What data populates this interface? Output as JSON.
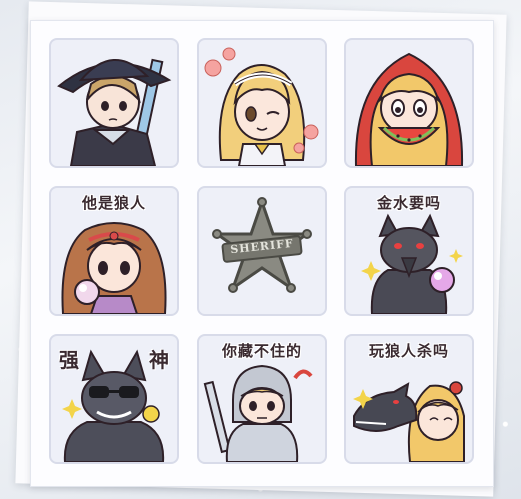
{
  "stickers": [
    {
      "name": "hunter-knight",
      "caption": ""
    },
    {
      "name": "blonde-girl-wink",
      "caption": ""
    },
    {
      "name": "red-hood-watermelon",
      "caption": ""
    },
    {
      "name": "fortune-teller",
      "caption": "他是狼人"
    },
    {
      "name": "sheriff-badge",
      "caption": "",
      "badge_text": "SHERIFF"
    },
    {
      "name": "wolf-crystal-ball",
      "caption": "金水要吗"
    },
    {
      "name": "wolf-sunglasses",
      "caption": "",
      "caption_left": "强",
      "caption_right": "神"
    },
    {
      "name": "knight-boy",
      "caption": "你藏不住的"
    },
    {
      "name": "wolf-and-girl",
      "caption": "玩狼人杀吗"
    }
  ],
  "colors": {
    "tile_bg": "#eef0f8",
    "tile_border": "#d8dbe9",
    "outline": "#2e2028",
    "badge": "#8a8a82"
  }
}
